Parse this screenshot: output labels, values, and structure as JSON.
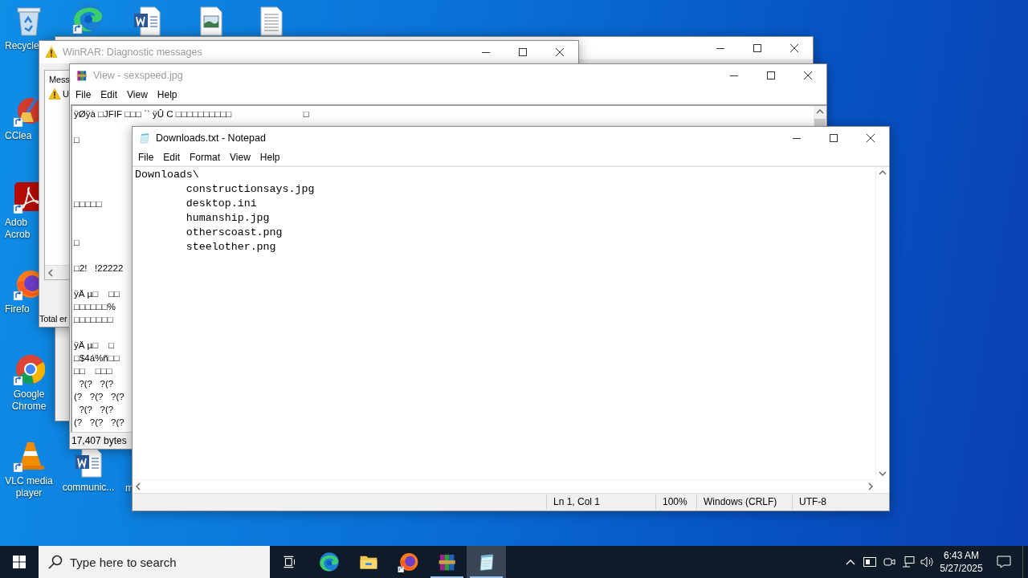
{
  "desktop_icons": [
    {
      "kind": "recycle_bin",
      "label": "Recycle"
    },
    {
      "kind": "edge"
    },
    {
      "kind": "word_document"
    },
    {
      "kind": "image_file"
    },
    {
      "kind": "text_file"
    },
    {
      "kind": "ccleaner",
      "label": "CClea"
    },
    {
      "kind": "acrobat",
      "label": "Adob Acrob"
    },
    {
      "kind": "firefox",
      "label": "Firefo"
    },
    {
      "kind": "chrome",
      "label": "Google Chrome"
    },
    {
      "kind": "vlc",
      "label": "VLC media player"
    },
    {
      "kind": "word_document",
      "label": "communic..."
    },
    {
      "kind": "covered",
      "label": "m"
    }
  ],
  "windows": [
    {
      "kind": "diagnostics",
      "title": "WinRAR: Diagnostic messages",
      "active": false,
      "column_header": "Mess",
      "rows": [
        "U"
      ],
      "summary": "Total er"
    },
    {
      "kind": "viewer",
      "title": "View - sexspeed.jpg",
      "active": false,
      "menu": [
        "File",
        "Edit",
        "View",
        "Help"
      ],
      "first_line": "ÿØÿà □JFIF □□□ `` ÿÛ C □□□□□□□□□□                            □",
      "content": "\n□\n\n\n\n\n□□□□□\n\n\n□\n\n□2!   !22222\n\nÿÄ µ□    □□\n□□□□□□%\n□□□□□□□\n\nÿÄ µ□    □\n□$4á%ñ□□\n□□    □□□\n  ?(?   ?(?\n(?   ?(?   ?(?\n  ?(?   ?(?\n(?   ?(?   ?(?",
      "status": "17,407 bytes"
    },
    {
      "kind": "notepad",
      "title": "Downloads.txt - Notepad",
      "active": true,
      "menu": [
        "File",
        "Edit",
        "Format",
        "View",
        "Help"
      ],
      "lines": [
        "Downloads\\",
        "\tconstructionsays.jpg",
        "\tdesktop.ini",
        "\thumanship.jpg",
        "\totherscoast.png",
        "\tsteelother.png"
      ],
      "status": [
        "Ln 1, Col 1",
        "100%",
        "Windows (CRLF)",
        "UTF-8"
      ]
    }
  ],
  "taskbar": {
    "search": {
      "placeholder": "Type here to search"
    },
    "apps": [
      {
        "kind": "task_view",
        "active": false,
        "running": false
      },
      {
        "kind": "edge",
        "active": false,
        "running": false
      },
      {
        "kind": "file_explorer",
        "active": false,
        "running": false
      },
      {
        "kind": "firefox",
        "active": false,
        "running": false
      },
      {
        "kind": "winrar",
        "active": false,
        "running": true
      },
      {
        "kind": "notepad",
        "active": true,
        "running": true
      }
    ],
    "clock": {
      "time": "6:43 AM",
      "date": "5/27/2025"
    }
  }
}
